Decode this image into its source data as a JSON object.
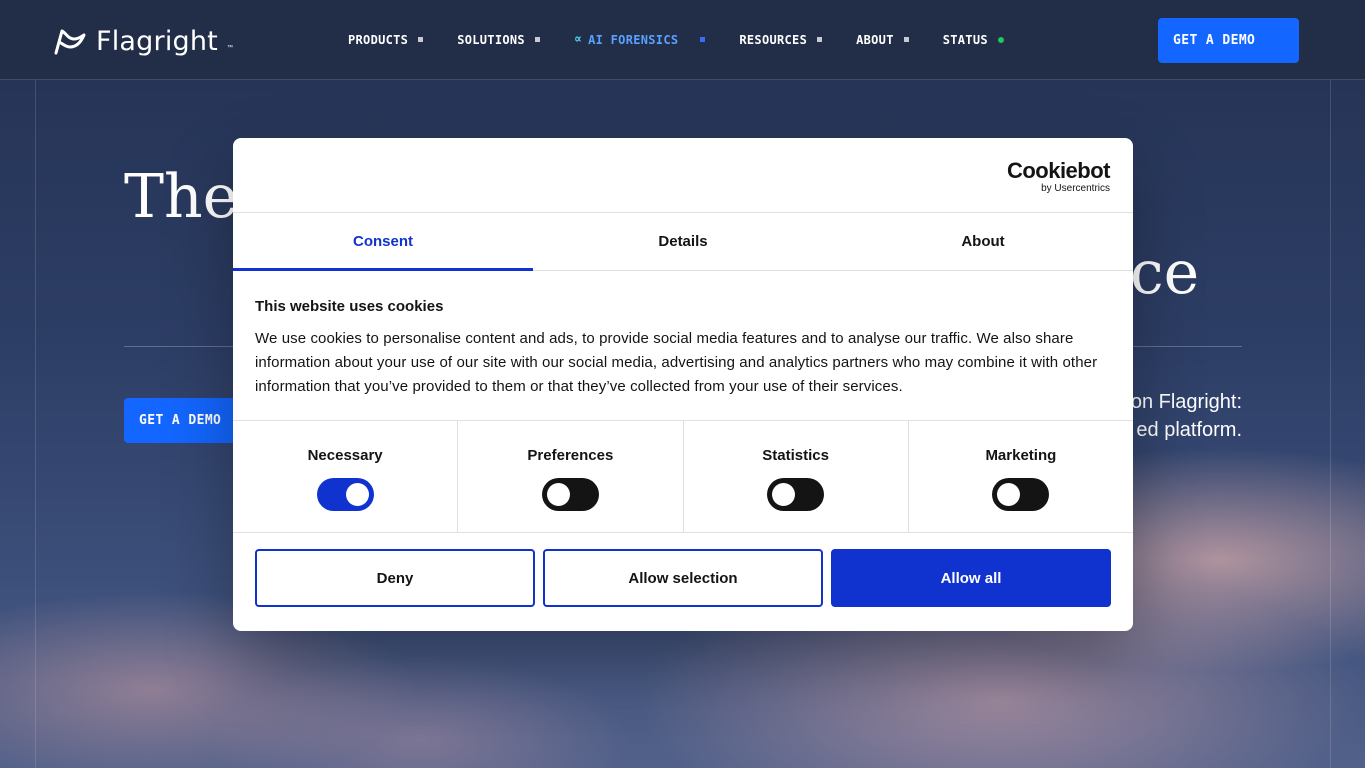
{
  "nav": {
    "brand": "Flagright",
    "brand_mark": "™",
    "items": [
      {
        "label": "PRODUCTS"
      },
      {
        "label": "SOLUTIONS"
      },
      {
        "label": "AI FORENSICS"
      },
      {
        "label": "RESOURCES"
      },
      {
        "label": "ABOUT"
      },
      {
        "label": "STATUS"
      }
    ],
    "cta_label": "GET A DEMO",
    "status_color": "#22c55e",
    "accent_color": "#1366ff"
  },
  "hero": {
    "title_start": "The",
    "title_end": "ce",
    "cta_label": "GET A DEMO",
    "sub_line_1": "on Flagright:",
    "sub_line_2": "ed platform."
  },
  "cookie": {
    "provider": "Cookiebot",
    "provider_sub": "by Usercentrics",
    "tabs": [
      {
        "label": "Consent",
        "active": true
      },
      {
        "label": "Details",
        "active": false
      },
      {
        "label": "About",
        "active": false
      }
    ],
    "heading": "This website uses cookies",
    "body": "We use cookies to personalise content and ads, to provide social media features and to analyse our traffic. We also share information about your use of our site with our social media, advertising and analytics partners who may combine it with other information that you’ve provided to them or that they’ve collected from your use of their services.",
    "toggles": [
      {
        "label": "Necessary",
        "on": true
      },
      {
        "label": "Preferences",
        "on": false
      },
      {
        "label": "Statistics",
        "on": false
      },
      {
        "label": "Marketing",
        "on": false
      }
    ],
    "buttons": {
      "deny": "Deny",
      "allow_selection": "Allow selection",
      "allow_all": "Allow all"
    },
    "accent_color": "#1032cf"
  }
}
